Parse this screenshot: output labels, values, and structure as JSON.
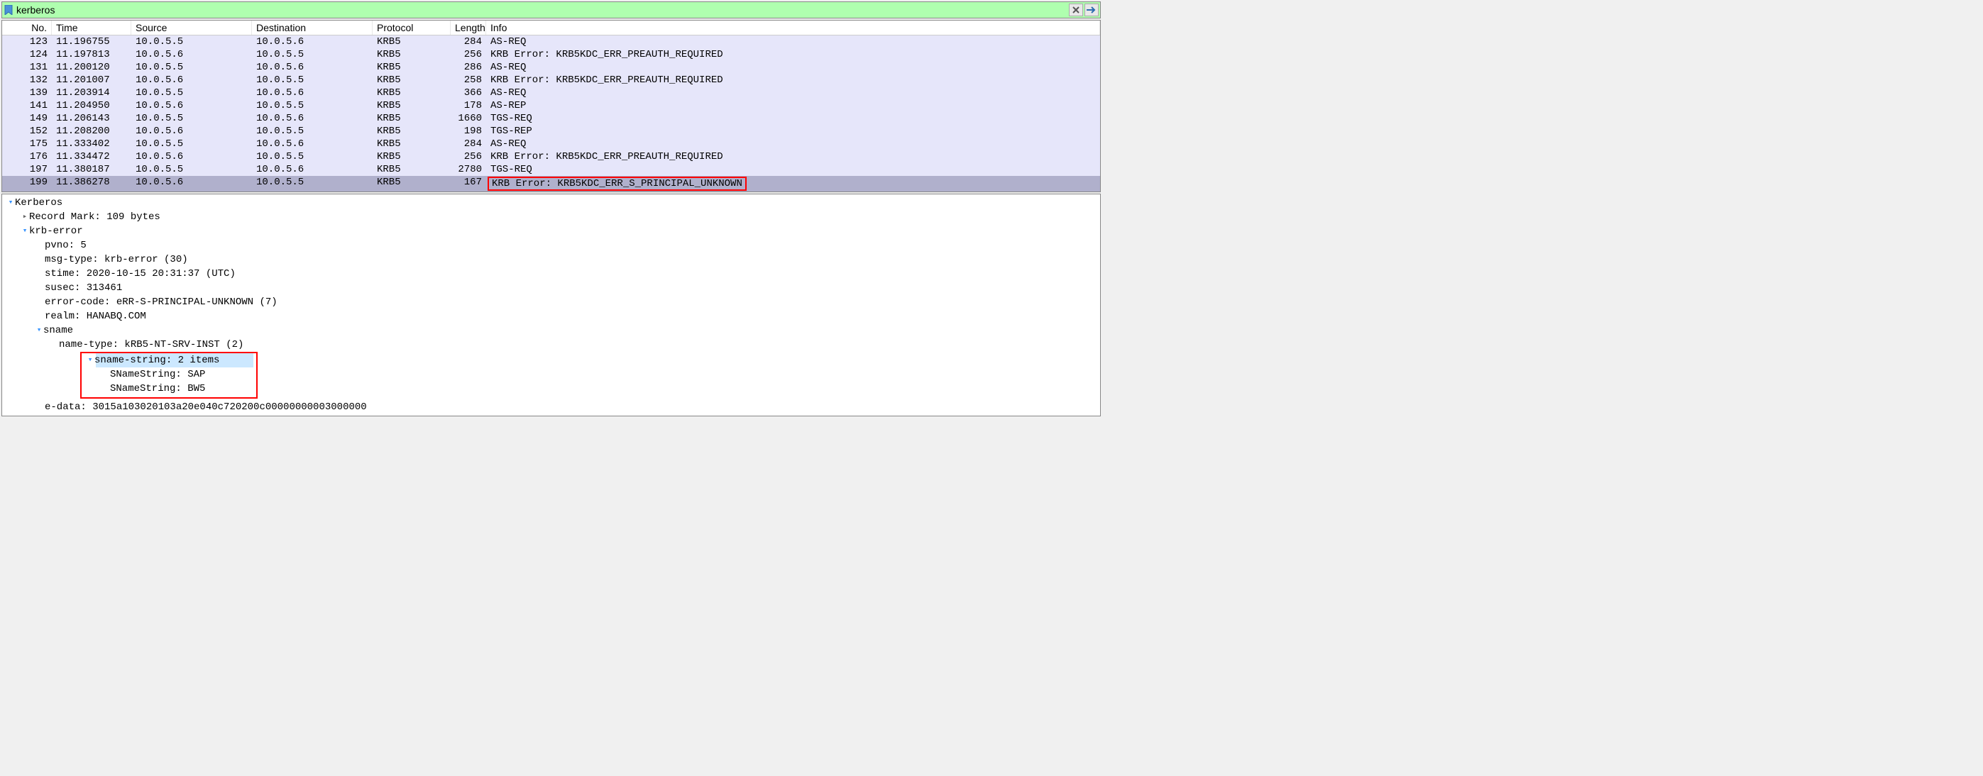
{
  "filter": {
    "value": "kerberos"
  },
  "columns": [
    "No.",
    "Time",
    "Source",
    "Destination",
    "Protocol",
    "Length",
    "Info"
  ],
  "packets": [
    {
      "no": "123",
      "time": "11.196755",
      "src": "10.0.5.5",
      "dst": "10.0.5.6",
      "proto": "KRB5",
      "len": "284",
      "info": "AS-REQ",
      "bg": 0
    },
    {
      "no": "124",
      "time": "11.197813",
      "src": "10.0.5.6",
      "dst": "10.0.5.5",
      "proto": "KRB5",
      "len": "256",
      "info": "KRB Error: KRB5KDC_ERR_PREAUTH_REQUIRED",
      "bg": 0
    },
    {
      "no": "131",
      "time": "11.200120",
      "src": "10.0.5.5",
      "dst": "10.0.5.6",
      "proto": "KRB5",
      "len": "286",
      "info": "AS-REQ",
      "bg": 0
    },
    {
      "no": "132",
      "time": "11.201007",
      "src": "10.0.5.6",
      "dst": "10.0.5.5",
      "proto": "KRB5",
      "len": "258",
      "info": "KRB Error: KRB5KDC_ERR_PREAUTH_REQUIRED",
      "bg": 0
    },
    {
      "no": "139",
      "time": "11.203914",
      "src": "10.0.5.5",
      "dst": "10.0.5.6",
      "proto": "KRB5",
      "len": "366",
      "info": "AS-REQ",
      "bg": 0
    },
    {
      "no": "141",
      "time": "11.204950",
      "src": "10.0.5.6",
      "dst": "10.0.5.5",
      "proto": "KRB5",
      "len": "178",
      "info": "AS-REP",
      "bg": 0
    },
    {
      "no": "149",
      "time": "11.206143",
      "src": "10.0.5.5",
      "dst": "10.0.5.6",
      "proto": "KRB5",
      "len": "1660",
      "info": "TGS-REQ",
      "bg": 0
    },
    {
      "no": "152",
      "time": "11.208200",
      "src": "10.0.5.6",
      "dst": "10.0.5.5",
      "proto": "KRB5",
      "len": "198",
      "info": "TGS-REP",
      "bg": 0
    },
    {
      "no": "175",
      "time": "11.333402",
      "src": "10.0.5.5",
      "dst": "10.0.5.6",
      "proto": "KRB5",
      "len": "284",
      "info": "AS-REQ",
      "bg": 0
    },
    {
      "no": "176",
      "time": "11.334472",
      "src": "10.0.5.6",
      "dst": "10.0.5.5",
      "proto": "KRB5",
      "len": "256",
      "info": "KRB Error: KRB5KDC_ERR_PREAUTH_REQUIRED",
      "bg": 0
    },
    {
      "no": "197",
      "time": "11.380187",
      "src": "10.0.5.5",
      "dst": "10.0.5.6",
      "proto": "KRB5",
      "len": "2780",
      "info": "TGS-REQ",
      "bg": 0
    },
    {
      "no": "199",
      "time": "11.386278",
      "src": "10.0.5.6",
      "dst": "10.0.5.5",
      "proto": "KRB5",
      "len": "167",
      "info": "KRB Error: KRB5KDC_ERR_S_PRINCIPAL_UNKNOWN",
      "bg": 1,
      "info_highlight": true
    }
  ],
  "details": {
    "root_label": "Kerberos",
    "record_mark": "Record Mark: 109 bytes",
    "krb_error_label": "krb-error",
    "pvno": "pvno: 5",
    "msg_type": "msg-type: krb-error (30)",
    "stime": "stime: 2020-10-15 20:31:37 (UTC)",
    "susec": "susec: 313461",
    "error_code": "error-code: eRR-S-PRINCIPAL-UNKNOWN (7)",
    "realm": "realm: HANABQ.COM",
    "sname_label": "sname",
    "name_type": "name-type: kRB5-NT-SRV-INST (2)",
    "sname_string_label": "sname-string: 2 items",
    "sname_item0": "SNameString: SAP",
    "sname_item1": "SNameString: BW5",
    "e_data": "e-data: 3015a103020103a20e040c720200c00000000003000000"
  }
}
